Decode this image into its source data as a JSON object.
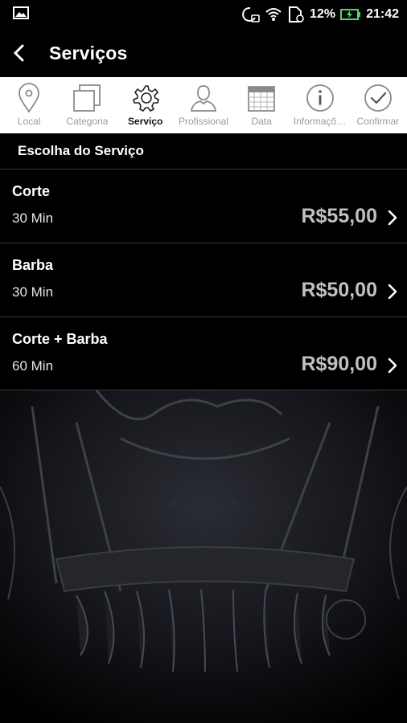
{
  "status_bar": {
    "battery": "12%",
    "time": "21:42"
  },
  "app_bar": {
    "title": "Serviços"
  },
  "steps": [
    {
      "label": "Local",
      "icon": "location-pin-icon",
      "active": false
    },
    {
      "label": "Categoria",
      "icon": "category-squares-icon",
      "active": false
    },
    {
      "label": "Serviço",
      "icon": "gear-icon",
      "active": true
    },
    {
      "label": "Profissional",
      "icon": "person-icon",
      "active": false
    },
    {
      "label": "Data",
      "icon": "calendar-icon",
      "active": false
    },
    {
      "label": "Informaçõ…",
      "icon": "info-icon",
      "active": false
    },
    {
      "label": "Confirmar",
      "icon": "check-circle-icon",
      "active": false
    }
  ],
  "section": {
    "title": "Escolha do Serviço"
  },
  "services": [
    {
      "name": "Corte",
      "duration": "30 Min",
      "price": "R$55,00"
    },
    {
      "name": "Barba",
      "duration": "30 Min",
      "price": "R$50,00"
    },
    {
      "name": "Corte + Barba",
      "duration": "60 Min",
      "price": "R$90,00"
    }
  ],
  "colors": {
    "background": "#000000",
    "step_bar": "#ffffff",
    "price": "#c0c0c0",
    "divider": "#3a3a3a"
  }
}
